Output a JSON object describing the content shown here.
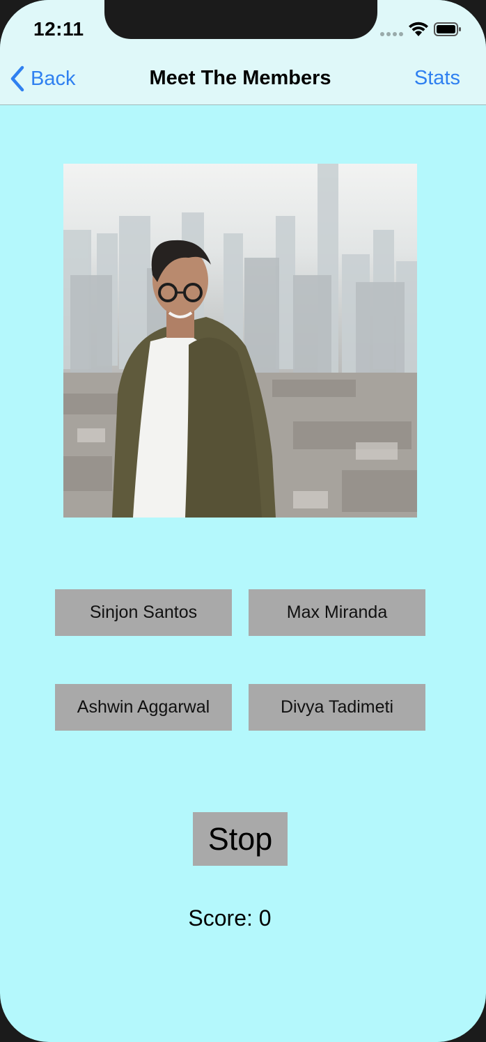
{
  "status_bar": {
    "time": "12:11",
    "wifi_icon": "wifi-icon",
    "battery_icon": "battery-icon",
    "signal_icon": "signal-dots-icon"
  },
  "nav": {
    "back_label": "Back",
    "title": "Meet The Members",
    "right_label": "Stats",
    "accent_color": "#2f80f0"
  },
  "photo": {
    "description_icon": "member-photo"
  },
  "answers": [
    "Sinjon Santos",
    "Max Miranda",
    "Ashwin Aggarwal",
    "Divya Tadimeti"
  ],
  "stop_label": "Stop",
  "score": {
    "text": "Score: 0"
  },
  "colors": {
    "background": "#b4f8fc",
    "nav_background": "#dff8f9",
    "button_background": "#a9a9a9"
  }
}
